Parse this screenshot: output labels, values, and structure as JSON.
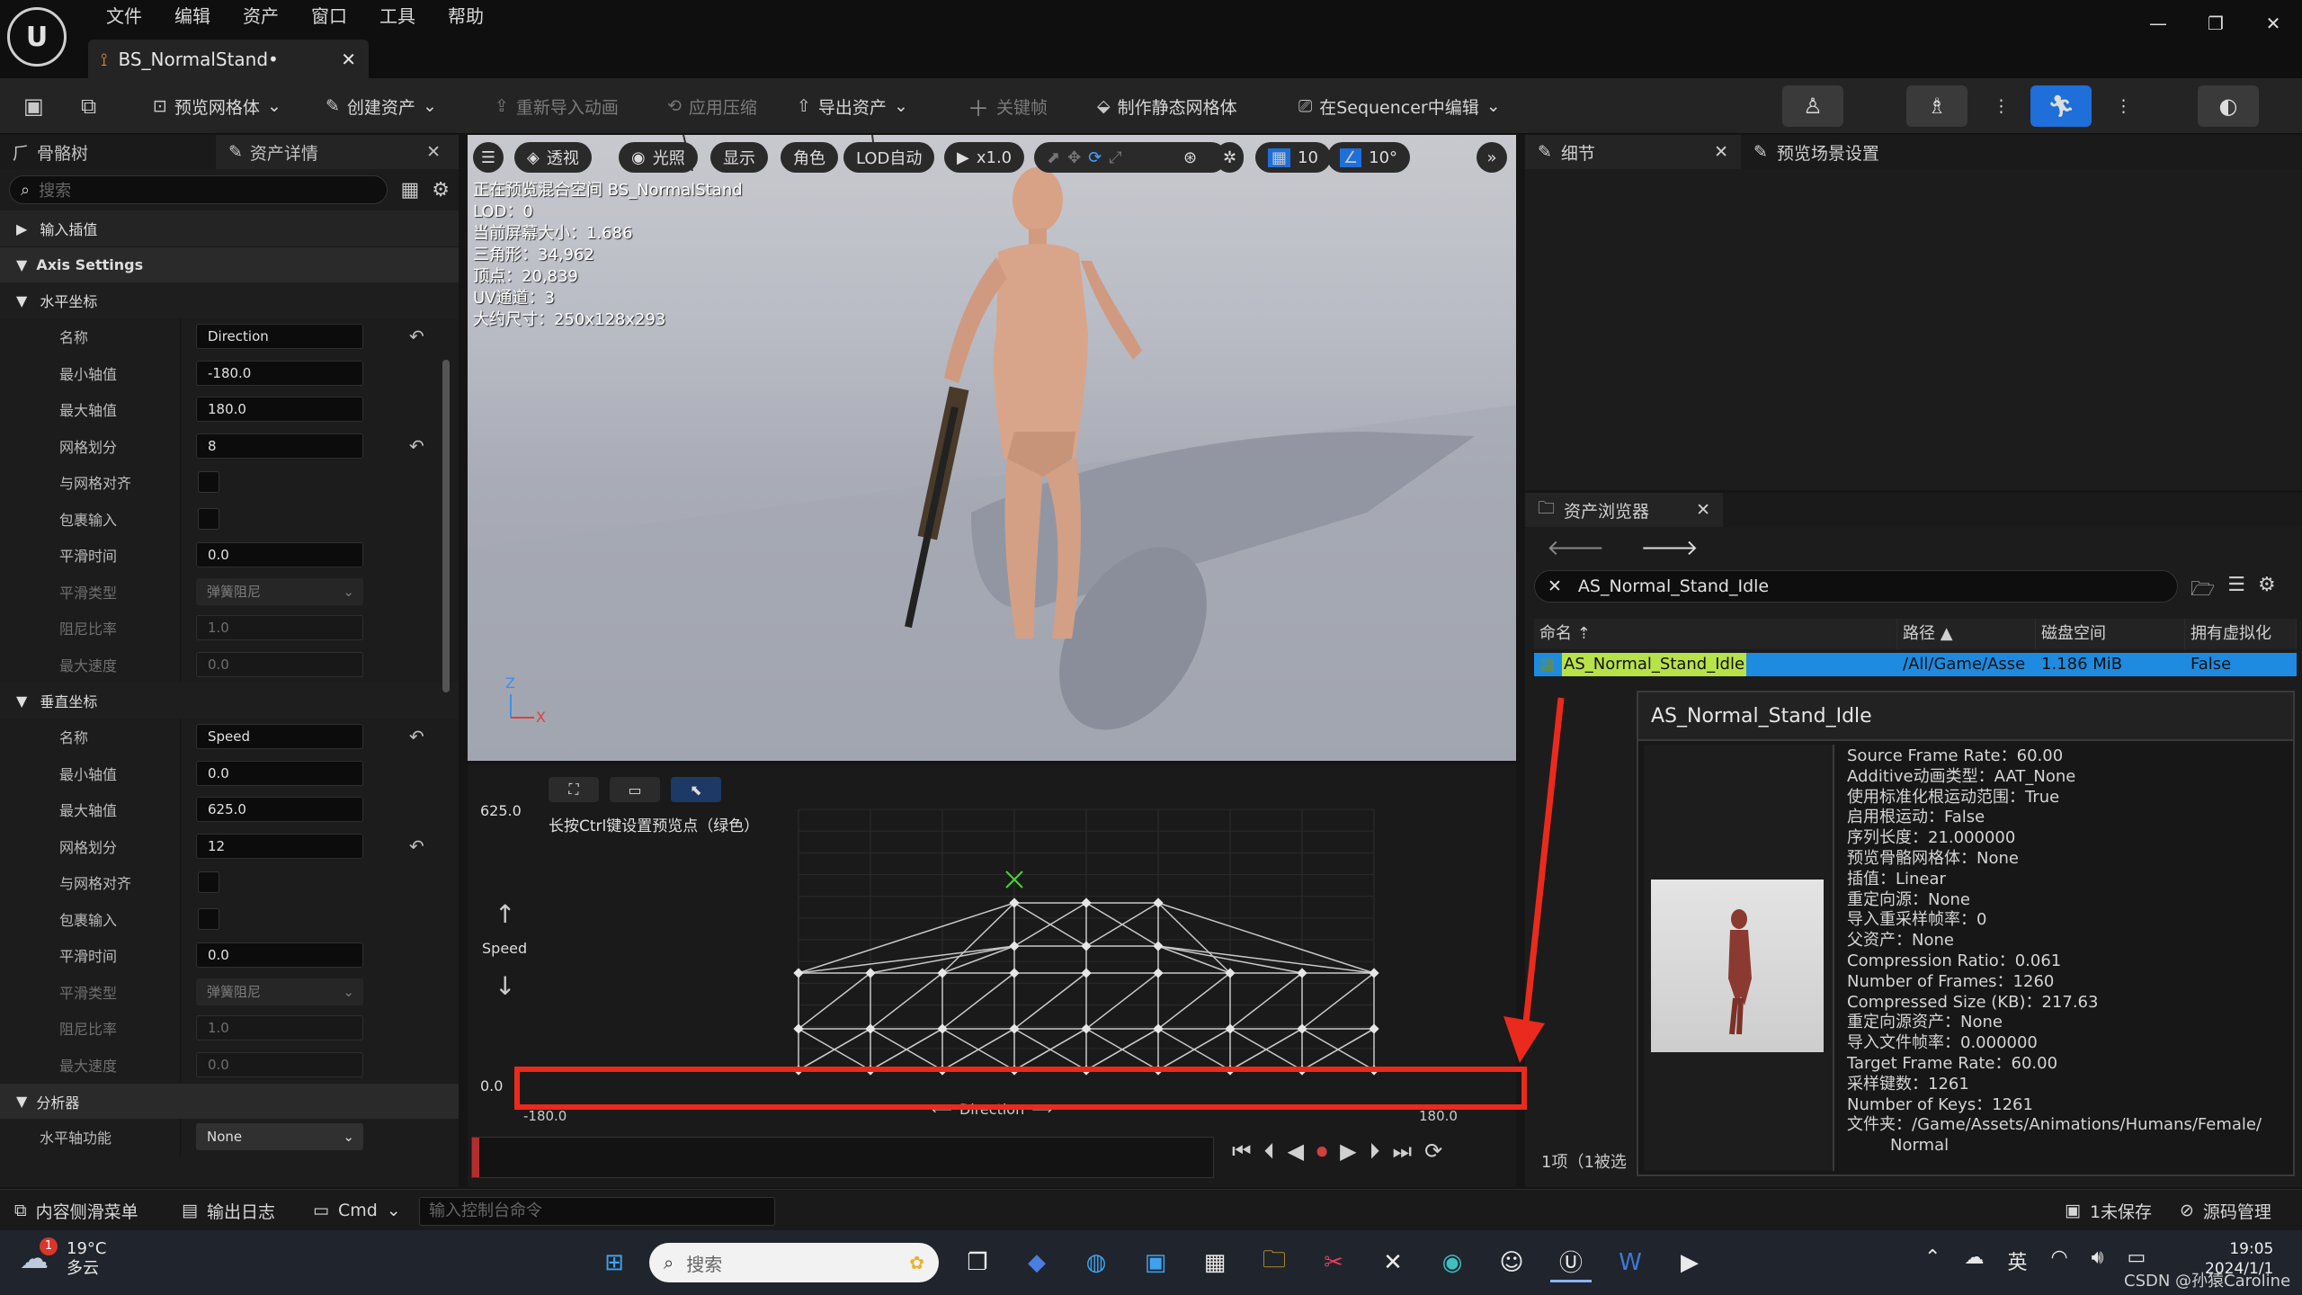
{
  "app": {
    "menu": [
      "文件",
      "编辑",
      "资产",
      "窗口",
      "工具",
      "帮助"
    ],
    "doc_tab": "BS_NormalStand•"
  },
  "toolbar": {
    "preview_mesh": "预览网格体",
    "create_asset": "创建资产",
    "reimport": "重新导入动画",
    "apply_compression": "应用压缩",
    "export_asset": "导出资产",
    "keyframe": "关键帧",
    "make_static_mesh": "制作静态网格体",
    "edit_in_sequencer": "在Sequencer中编辑"
  },
  "left_panel": {
    "tabs": [
      "骨骼树",
      "资产详情"
    ],
    "search_placeholder": "搜索",
    "input_interp": "输入插值",
    "axis_settings": "Axis Settings",
    "horizontal": {
      "title": "水平坐标",
      "rows": [
        {
          "label": "名称",
          "value": "Direction",
          "type": "text",
          "reset": true
        },
        {
          "label": "最小轴值",
          "value": "-180.0",
          "type": "text"
        },
        {
          "label": "最大轴值",
          "value": "180.0",
          "type": "text"
        },
        {
          "label": "网格划分",
          "value": "8",
          "type": "text",
          "reset": true
        },
        {
          "label": "与网格对齐",
          "type": "check"
        },
        {
          "label": "包裹输入",
          "type": "check"
        },
        {
          "label": "平滑时间",
          "value": "0.0",
          "type": "text"
        },
        {
          "label": "平滑类型",
          "value": "弹簧阻尼",
          "type": "dd",
          "dim": true
        },
        {
          "label": "阻尼比率",
          "value": "1.0",
          "type": "text",
          "dim": true
        },
        {
          "label": "最大速度",
          "value": "0.0",
          "type": "text",
          "dim": true
        }
      ]
    },
    "vertical": {
      "title": "垂直坐标",
      "rows": [
        {
          "label": "名称",
          "value": "Speed",
          "type": "text",
          "reset": true
        },
        {
          "label": "最小轴值",
          "value": "0.0",
          "type": "text"
        },
        {
          "label": "最大轴值",
          "value": "625.0",
          "type": "text"
        },
        {
          "label": "网格划分",
          "value": "12",
          "type": "text",
          "reset": true
        },
        {
          "label": "与网格对齐",
          "type": "check"
        },
        {
          "label": "包裹输入",
          "type": "check"
        },
        {
          "label": "平滑时间",
          "value": "0.0",
          "type": "text"
        },
        {
          "label": "平滑类型",
          "value": "弹簧阻尼",
          "type": "dd",
          "dim": true
        },
        {
          "label": "阻尼比率",
          "value": "1.0",
          "type": "text",
          "dim": true
        },
        {
          "label": "最大速度",
          "value": "0.0",
          "type": "text",
          "dim": true
        }
      ]
    },
    "analyzer": "分析器",
    "h_axis_function": {
      "label": "水平轴功能",
      "value": "None"
    }
  },
  "viewport": {
    "buttons": {
      "perspective": "透视",
      "lit": "光照",
      "show": "显示",
      "character": "角色",
      "lod": "LOD自动",
      "speed": "x1.0",
      "grid": "10",
      "angle": "10°"
    },
    "info": [
      "正在预览混合空间 BS_NormalStand",
      "LOD：0",
      "当前屏幕大小：1.686",
      "三角形：34,962",
      "顶点：20,839",
      "UV通道：3",
      "大约尺寸：250x128x293"
    ]
  },
  "blendspace": {
    "y_max_label": "625.0",
    "y_min_label": "0.0",
    "y_axis_name": "Speed",
    "x_min_label": "-180.0",
    "x_max_label": "180.0",
    "x_axis_name": "Direction",
    "hint": "长按Ctrl键设置预览点（绿色）"
  },
  "details_panel": {
    "tabs": [
      "细节",
      "预览场景设置"
    ]
  },
  "content_browser": {
    "title": "资产浏览器",
    "search": "AS_Normal_Stand_Idle",
    "columns": [
      "命名",
      "路径",
      "磁盘空间",
      "拥有虚拟化"
    ],
    "row": {
      "name": "AS_Normal_Stand_Idle",
      "path": "/All/Game/Asse",
      "size": "1.186 MiB",
      "virtual": "False"
    },
    "footer": "1项（1被选"
  },
  "tooltip": {
    "title": "AS_Normal_Stand_Idle",
    "props": [
      "Source Frame Rate：60.00",
      "Additive动画类型：AAT_None",
      "使用标准化根运动范围：True",
      "启用根运动：False",
      "序列长度：21.000000",
      "预览骨骼网格体：None",
      "插值：Linear",
      "重定向源：None",
      "导入重采样帧率：0",
      "父资产：None",
      "Compression Ratio：0.061",
      "Number of Frames：1260",
      "Compressed Size (KB)：217.63",
      "重定向源资产：None",
      "导入文件帧率：0.000000",
      "Target Frame Rate：60.00",
      "采样键数：1261",
      "Number of Keys：1261",
      "文件夹：/Game/Assets/Animations/Humans/Female/",
      "Normal"
    ]
  },
  "statusbar": {
    "content_drawer": "内容侧滑菜单",
    "output_log": "输出日志",
    "cmd": "Cmd",
    "cmd_placeholder": "输入控制台命令",
    "unsaved": "1未保存",
    "source_control": "源码管理"
  },
  "taskbar": {
    "badge": "1",
    "temp": "19°C",
    "weather": "多云",
    "search": "搜索",
    "ime": "英",
    "time": "19:05",
    "date": "2024/1/1",
    "watermark": "CSDN @孙猿Caroline"
  },
  "colors": {
    "accent": "#1e8be0",
    "annotation": "#ea2a1d",
    "ue_bg": "#1c1c1c"
  }
}
